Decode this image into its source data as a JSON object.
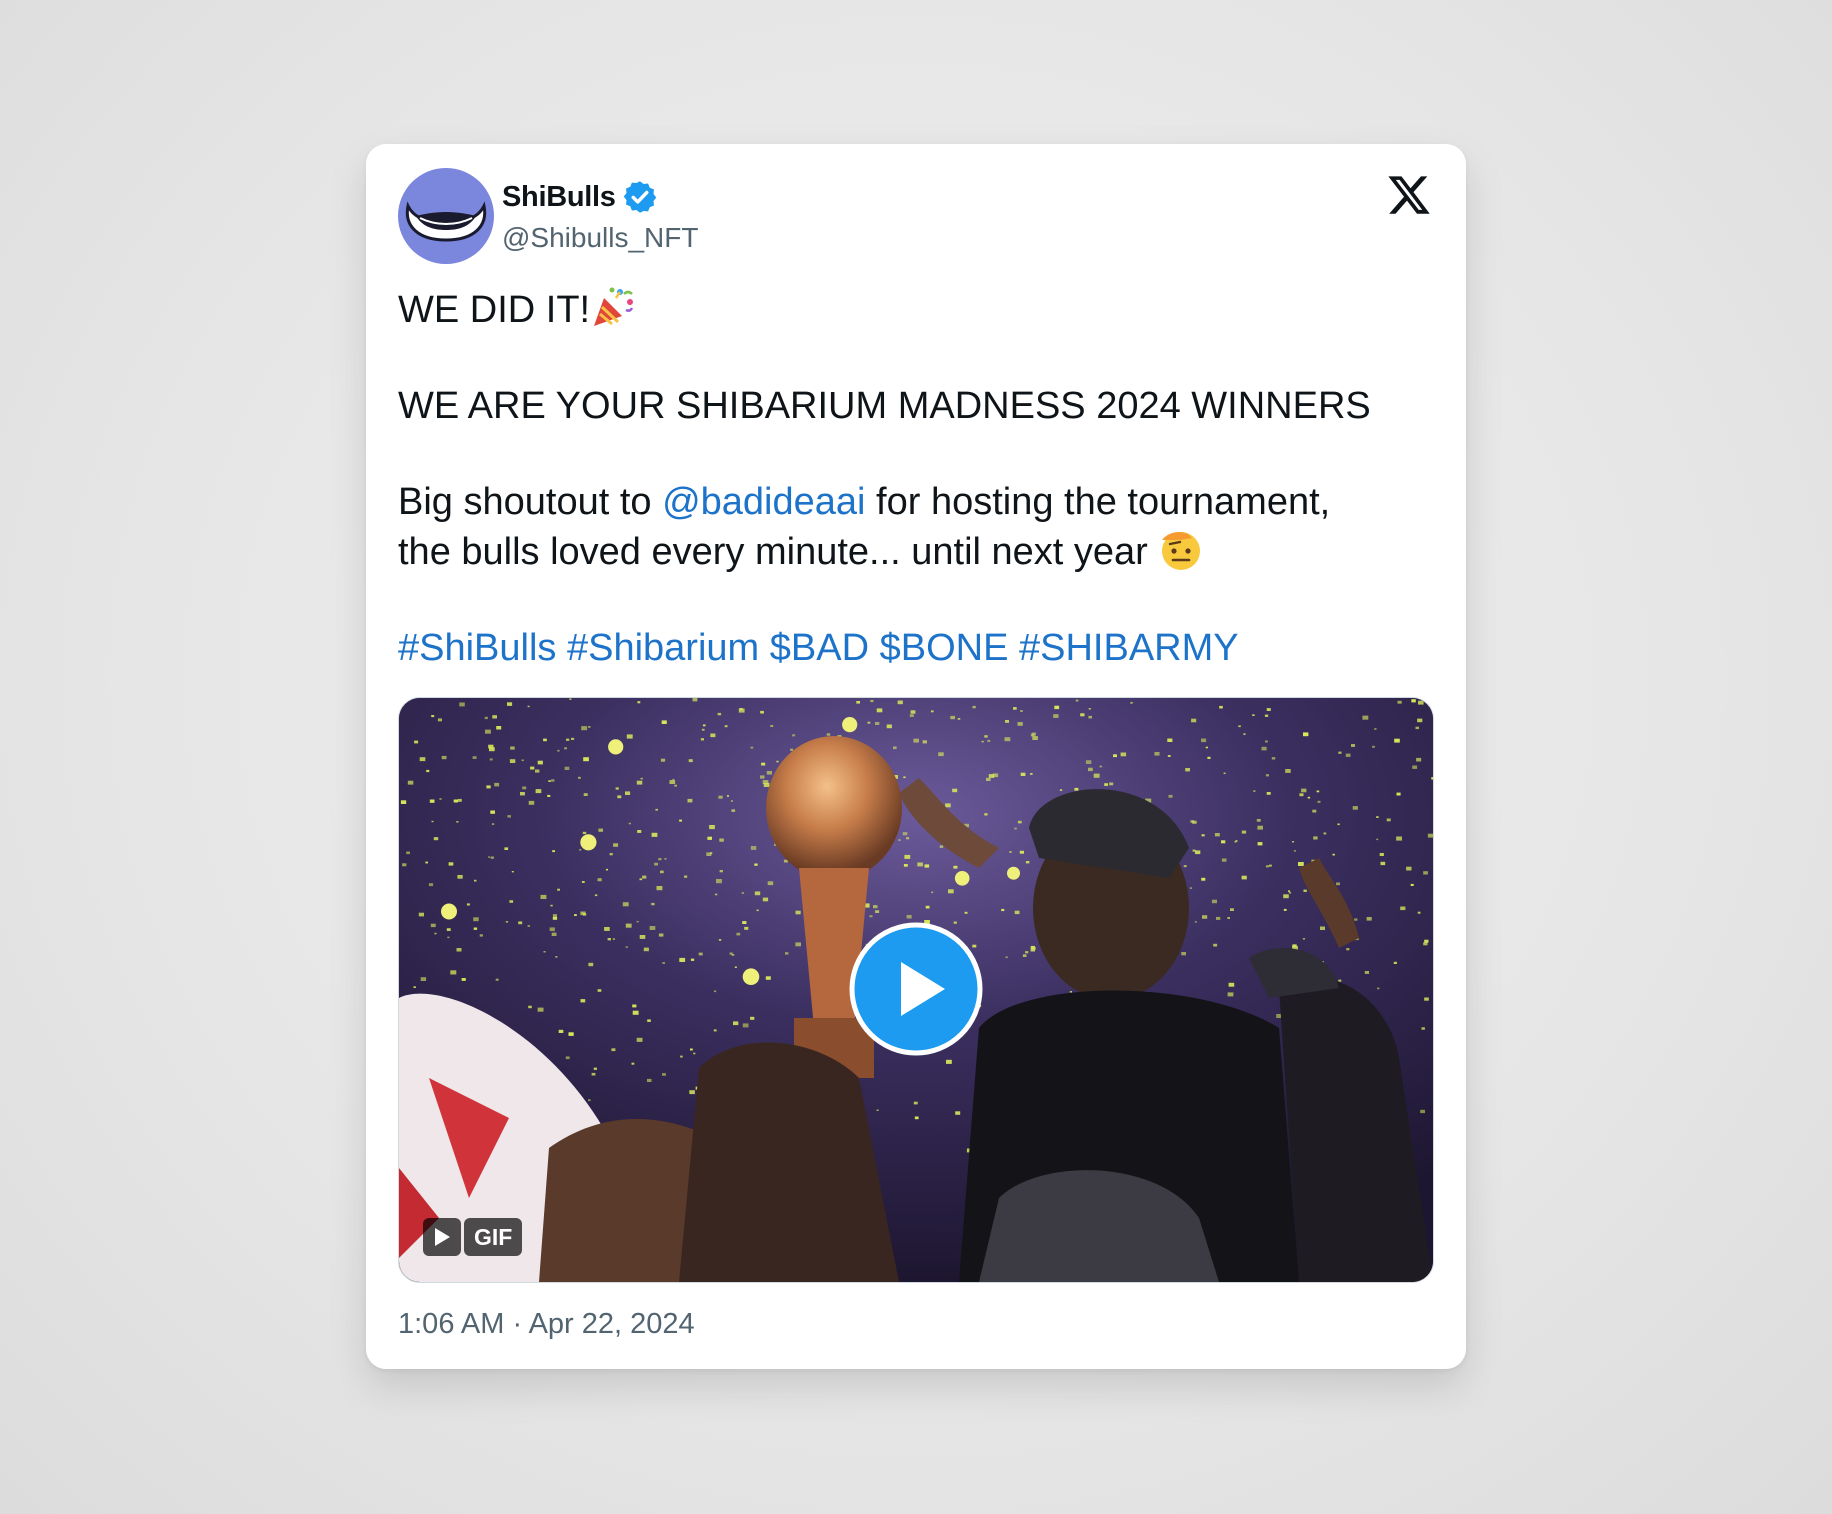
{
  "author": {
    "name": "ShiBulls",
    "handle": "@Shibulls_NFT",
    "verified": true
  },
  "icons": {
    "avatar": "bull-horns-avatar",
    "verified": "verified-badge-icon",
    "platform": "x-logo-icon",
    "play": "play-icon"
  },
  "tweet": {
    "line1": "WE DID IT!",
    "line1_emoji": "party-popper-emoji",
    "line2": "WE ARE YOUR SHIBARIUM MADNESS 2024 WINNERS",
    "line3_prefix": "Big shoutout to ",
    "line3_mention": "@badideaai",
    "line3_suffix": " for hosting the tournament,",
    "line4": "the bulls loved every minute... until next year ",
    "line4_emoji": "saluting-face-emoji",
    "hashtags": [
      "#ShiBulls",
      "#Shibarium",
      "$BAD",
      "$BONE",
      "#SHIBARMY"
    ]
  },
  "media": {
    "badge_label": "GIF"
  },
  "timestamp": "1:06 AM · Apr 22, 2024",
  "colors": {
    "avatar_bg": "#7b86dd",
    "link": "#1d73c9",
    "verified": "#1d9bf0",
    "play_button": "#1d9bf0",
    "text": "#0f1419",
    "muted": "#536471"
  }
}
